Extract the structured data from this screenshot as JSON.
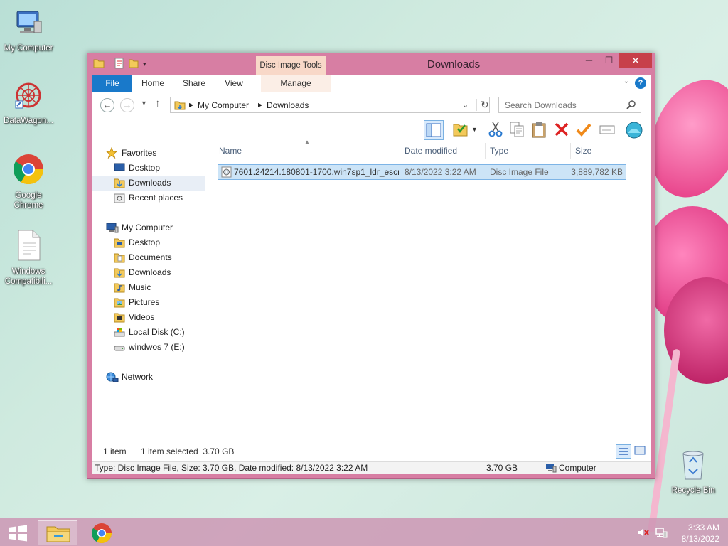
{
  "desktop": {
    "icons": [
      {
        "label": "My Computer"
      },
      {
        "label": "DataWagon..."
      },
      {
        "label": "Google Chrome"
      },
      {
        "label": "Windows Compatibili..."
      },
      {
        "label": "Recycle Bin"
      }
    ]
  },
  "window": {
    "title": "Downloads",
    "context_tab_header": "Disc Image Tools",
    "tabs": {
      "file": "File",
      "home": "Home",
      "share": "Share",
      "view": "View",
      "manage": "Manage"
    },
    "address": {
      "root": "My Computer",
      "current": "Downloads"
    },
    "search_placeholder": "Search Downloads",
    "nav": {
      "favorites": "Favorites",
      "fav_desktop": "Desktop",
      "fav_downloads": "Downloads",
      "fav_recent": "Recent places",
      "computer": "My Computer",
      "pc_desktop": "Desktop",
      "pc_documents": "Documents",
      "pc_downloads": "Downloads",
      "pc_music": "Music",
      "pc_pictures": "Pictures",
      "pc_videos": "Videos",
      "pc_local_disk": "Local Disk (C:)",
      "pc_windows7": "windwos 7 (E:)",
      "network": "Network"
    },
    "columns": {
      "name": "Name",
      "date": "Date modified",
      "type": "Type",
      "size": "Size"
    },
    "files": [
      {
        "name": "7601.24214.180801-1700.win7sp1_ldr_escr...",
        "date": "8/13/2022 3:22 AM",
        "type": "Disc Image File",
        "size": "3,889,782 KB"
      }
    ],
    "status": {
      "count": "1 item",
      "selected": "1 item selected  3.70 GB"
    },
    "details": {
      "info": "Type: Disc Image File, Size: 3.70 GB, Date modified: 8/13/2022 3:22 AM",
      "size": "3.70 GB",
      "location": "Computer"
    }
  },
  "taskbar": {
    "time": "3:33 AM",
    "date": "8/13/2022"
  },
  "colors": {
    "accent": "#1979ca",
    "window_frame": "#d77ea3",
    "selection": "#cce4f7",
    "close": "#c7404a"
  }
}
